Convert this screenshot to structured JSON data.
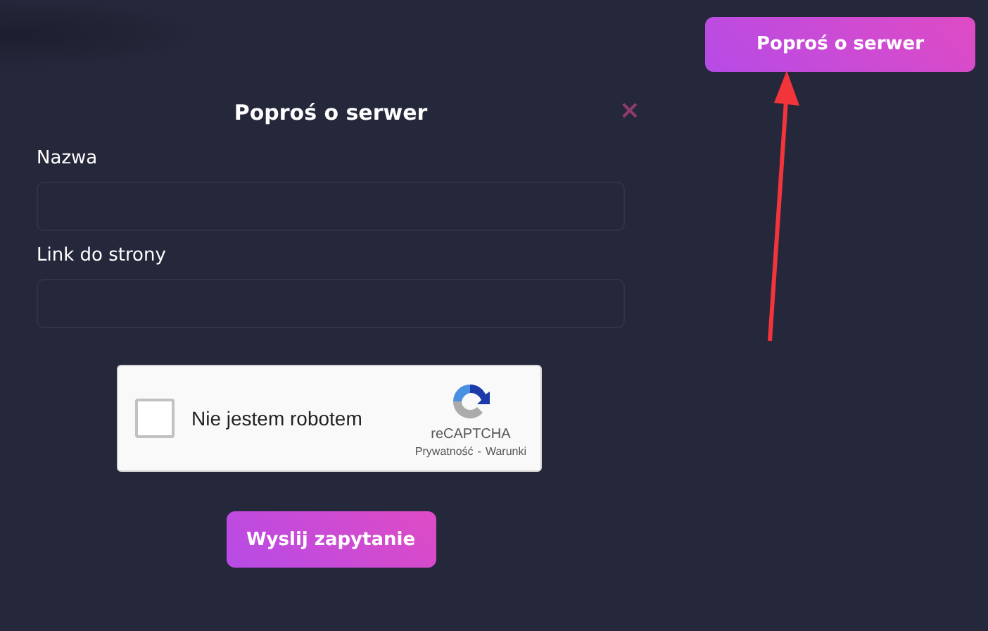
{
  "header_button": "Poproś o serwer",
  "modal": {
    "title": "Poproś o serwer",
    "close": "×",
    "fields": [
      {
        "label": "Nazwa"
      },
      {
        "label": "Link do strony"
      }
    ],
    "captcha": {
      "label": "Nie jestem robotem",
      "checked": false,
      "brand": "reCAPTCHA",
      "links": [
        "Prywatność",
        "Warunki"
      ],
      "separator": "-"
    },
    "submit": "Wyslij zapytanie"
  }
}
